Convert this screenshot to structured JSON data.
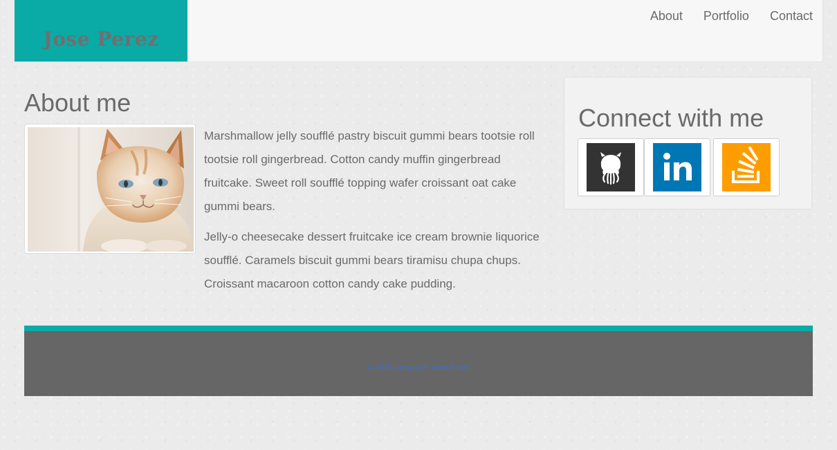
{
  "header": {
    "brand": "Jose Perez",
    "nav": [
      {
        "label": "About"
      },
      {
        "label": "Portfolio"
      },
      {
        "label": "Contact"
      }
    ]
  },
  "about": {
    "title": "About me",
    "paragraphs": [
      "Marshmallow jelly soufflé pastry biscuit gummi bears tootsie roll tootsie roll gingerbread. Cotton candy muffin gingerbread fruitcake. Sweet roll soufflé topping wafer croissant oat cake gummi bears.",
      "Jelly-o cheesecake dessert fruitcake ice cream brownie liquorice soufflé. Caramels biscuit gummi bears tiramisu chupa chups. Croissant macaroon cotton candy cake pudding."
    ]
  },
  "connect": {
    "title": "Connect with me",
    "links": [
      {
        "icon": "github-icon",
        "color": "#333333"
      },
      {
        "icon": "linkedin-icon",
        "color": "#0077b5"
      },
      {
        "icon": "stackoverflow-icon",
        "color": "#fe9d00"
      }
    ]
  },
  "footer": {
    "text": "© 2016 Copyright: Jose Perez"
  },
  "colors": {
    "accent": "#0aaba6",
    "footer_bg": "#666666",
    "footer_link": "#3a6fd6"
  }
}
